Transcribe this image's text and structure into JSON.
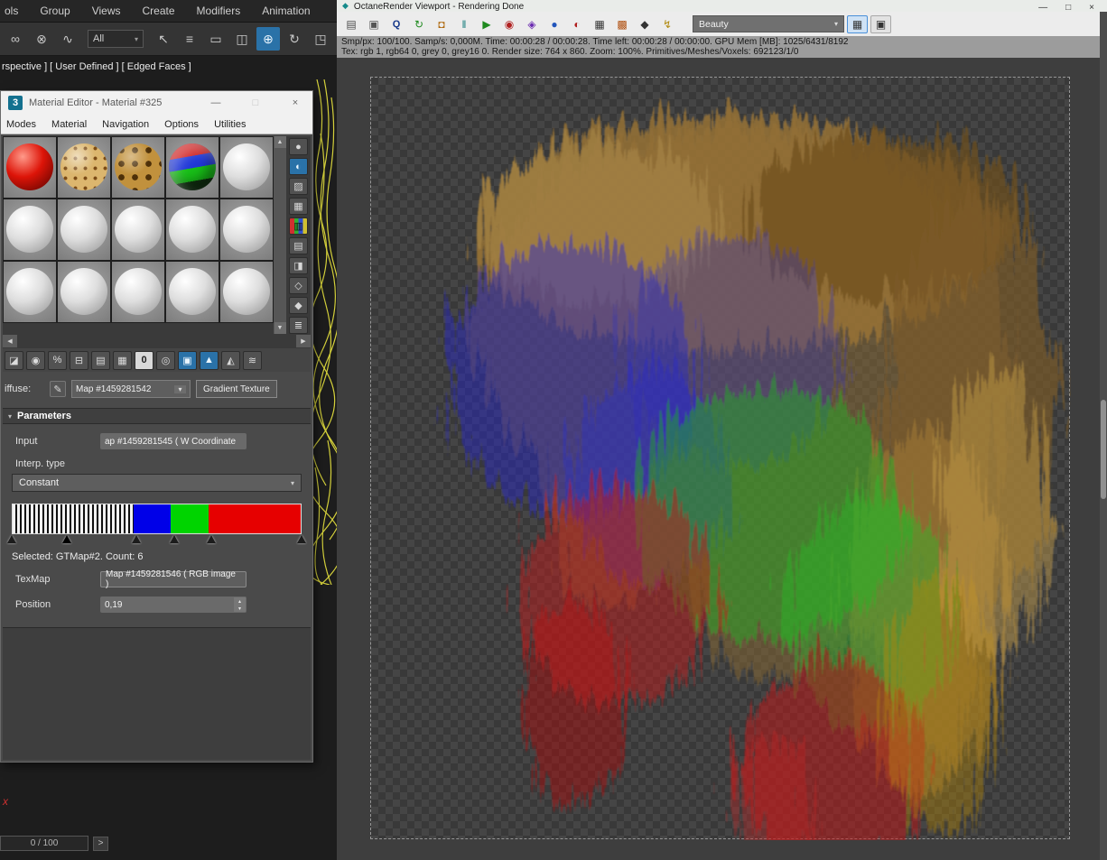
{
  "icons": {
    "dropdown_arrow": "▾",
    "rollout_arrow": "▾",
    "minimize": "—",
    "maximize": "□",
    "close": "×",
    "scroll_up": "▲",
    "scroll_down": "▼",
    "scroll_left": "◀",
    "scroll_right": "▶",
    "spinner_up": "▴",
    "spinner_down": "▾",
    "eyedropper": "✎",
    "octane_app": "◆"
  },
  "max": {
    "menu_items": [
      "ols",
      "Group",
      "Views",
      "Create",
      "Modifiers",
      "Animation"
    ],
    "toolbar_glyphs": [
      "∞",
      "⊗",
      "∿",
      "↖",
      "≡",
      "▭",
      "◫",
      "⊕",
      "↻",
      "◳"
    ],
    "selection_filter_value": "All",
    "viewport_label": "rspective ] [ User Defined ] [ Edged Faces ]",
    "axis_label": "x",
    "timeline_value": "0 / 100",
    "timeline_next_label": ">"
  },
  "material_editor": {
    "logo": "3",
    "title": "Material Editor - Material #325",
    "menus": [
      "Modes",
      "Material",
      "Navigation",
      "Options",
      "Utilities"
    ],
    "side_glyphs": [
      "●",
      "◐",
      "▨",
      "▦",
      "▥",
      "▤",
      "◨",
      "◇",
      "◆",
      "≣"
    ],
    "toolbar_glyphs": [
      "◪",
      "◉",
      "%",
      "⊟",
      "▤",
      "▦",
      "0",
      "◎",
      "▣",
      "▲",
      "◭",
      "≋"
    ],
    "diffuse_label": "iffuse:",
    "map_name": "Map #1459281542",
    "map_type_label": "Gradient Texture",
    "params_header": "Parameters",
    "input_label": "Input",
    "input_value": "ap #1459281545  ( W Coordinate",
    "interp_label": "Interp. type",
    "interp_value": "Constant",
    "gradient": {
      "segments": [
        {
          "type": "stripes",
          "width_pct": 42
        },
        {
          "type": "solid",
          "color": "#0000e8",
          "width_pct": 13
        },
        {
          "type": "solid",
          "color": "#00d400",
          "width_pct": 13
        },
        {
          "type": "solid",
          "color": "#e60000",
          "width_pct": 32
        }
      ],
      "flag_positions_pct": [
        0,
        19,
        43,
        56,
        69,
        100
      ],
      "selected_flag_index": 1
    },
    "selected_info": "Selected: GTMap#2. Count: 6",
    "texmap_label": "TexMap",
    "texmap_value": "Map #1459281546  ( RGB image )",
    "position_label": "Position",
    "position_value": "0,19"
  },
  "octane": {
    "title": "OctaneRender Viewport - Rendering Done",
    "toolbar_glyphs": [
      "▤",
      "▣",
      "Q",
      "↻",
      "◘",
      "‖",
      "▶",
      "◉",
      "◈",
      "●",
      "◐",
      "▦",
      "▩",
      "◆",
      "↯"
    ],
    "render_mode_value": "Beauty",
    "status_line1": "Smp/px: 100/100.   Samp/s: 0,000M.   Time: 00:00:28 / 00:00:28.   Time left: 00:00:28 / 00:00:00.   GPU Mem [MB]:  1025/6431/8192",
    "status_line2": "Tex: rgb 1, rgb64 0, grey 0, grey16 0.   Render size: 764 x 860.   Zoom: 100%.   Primitives/Meshes/Voxels: 692123/1/0"
  }
}
